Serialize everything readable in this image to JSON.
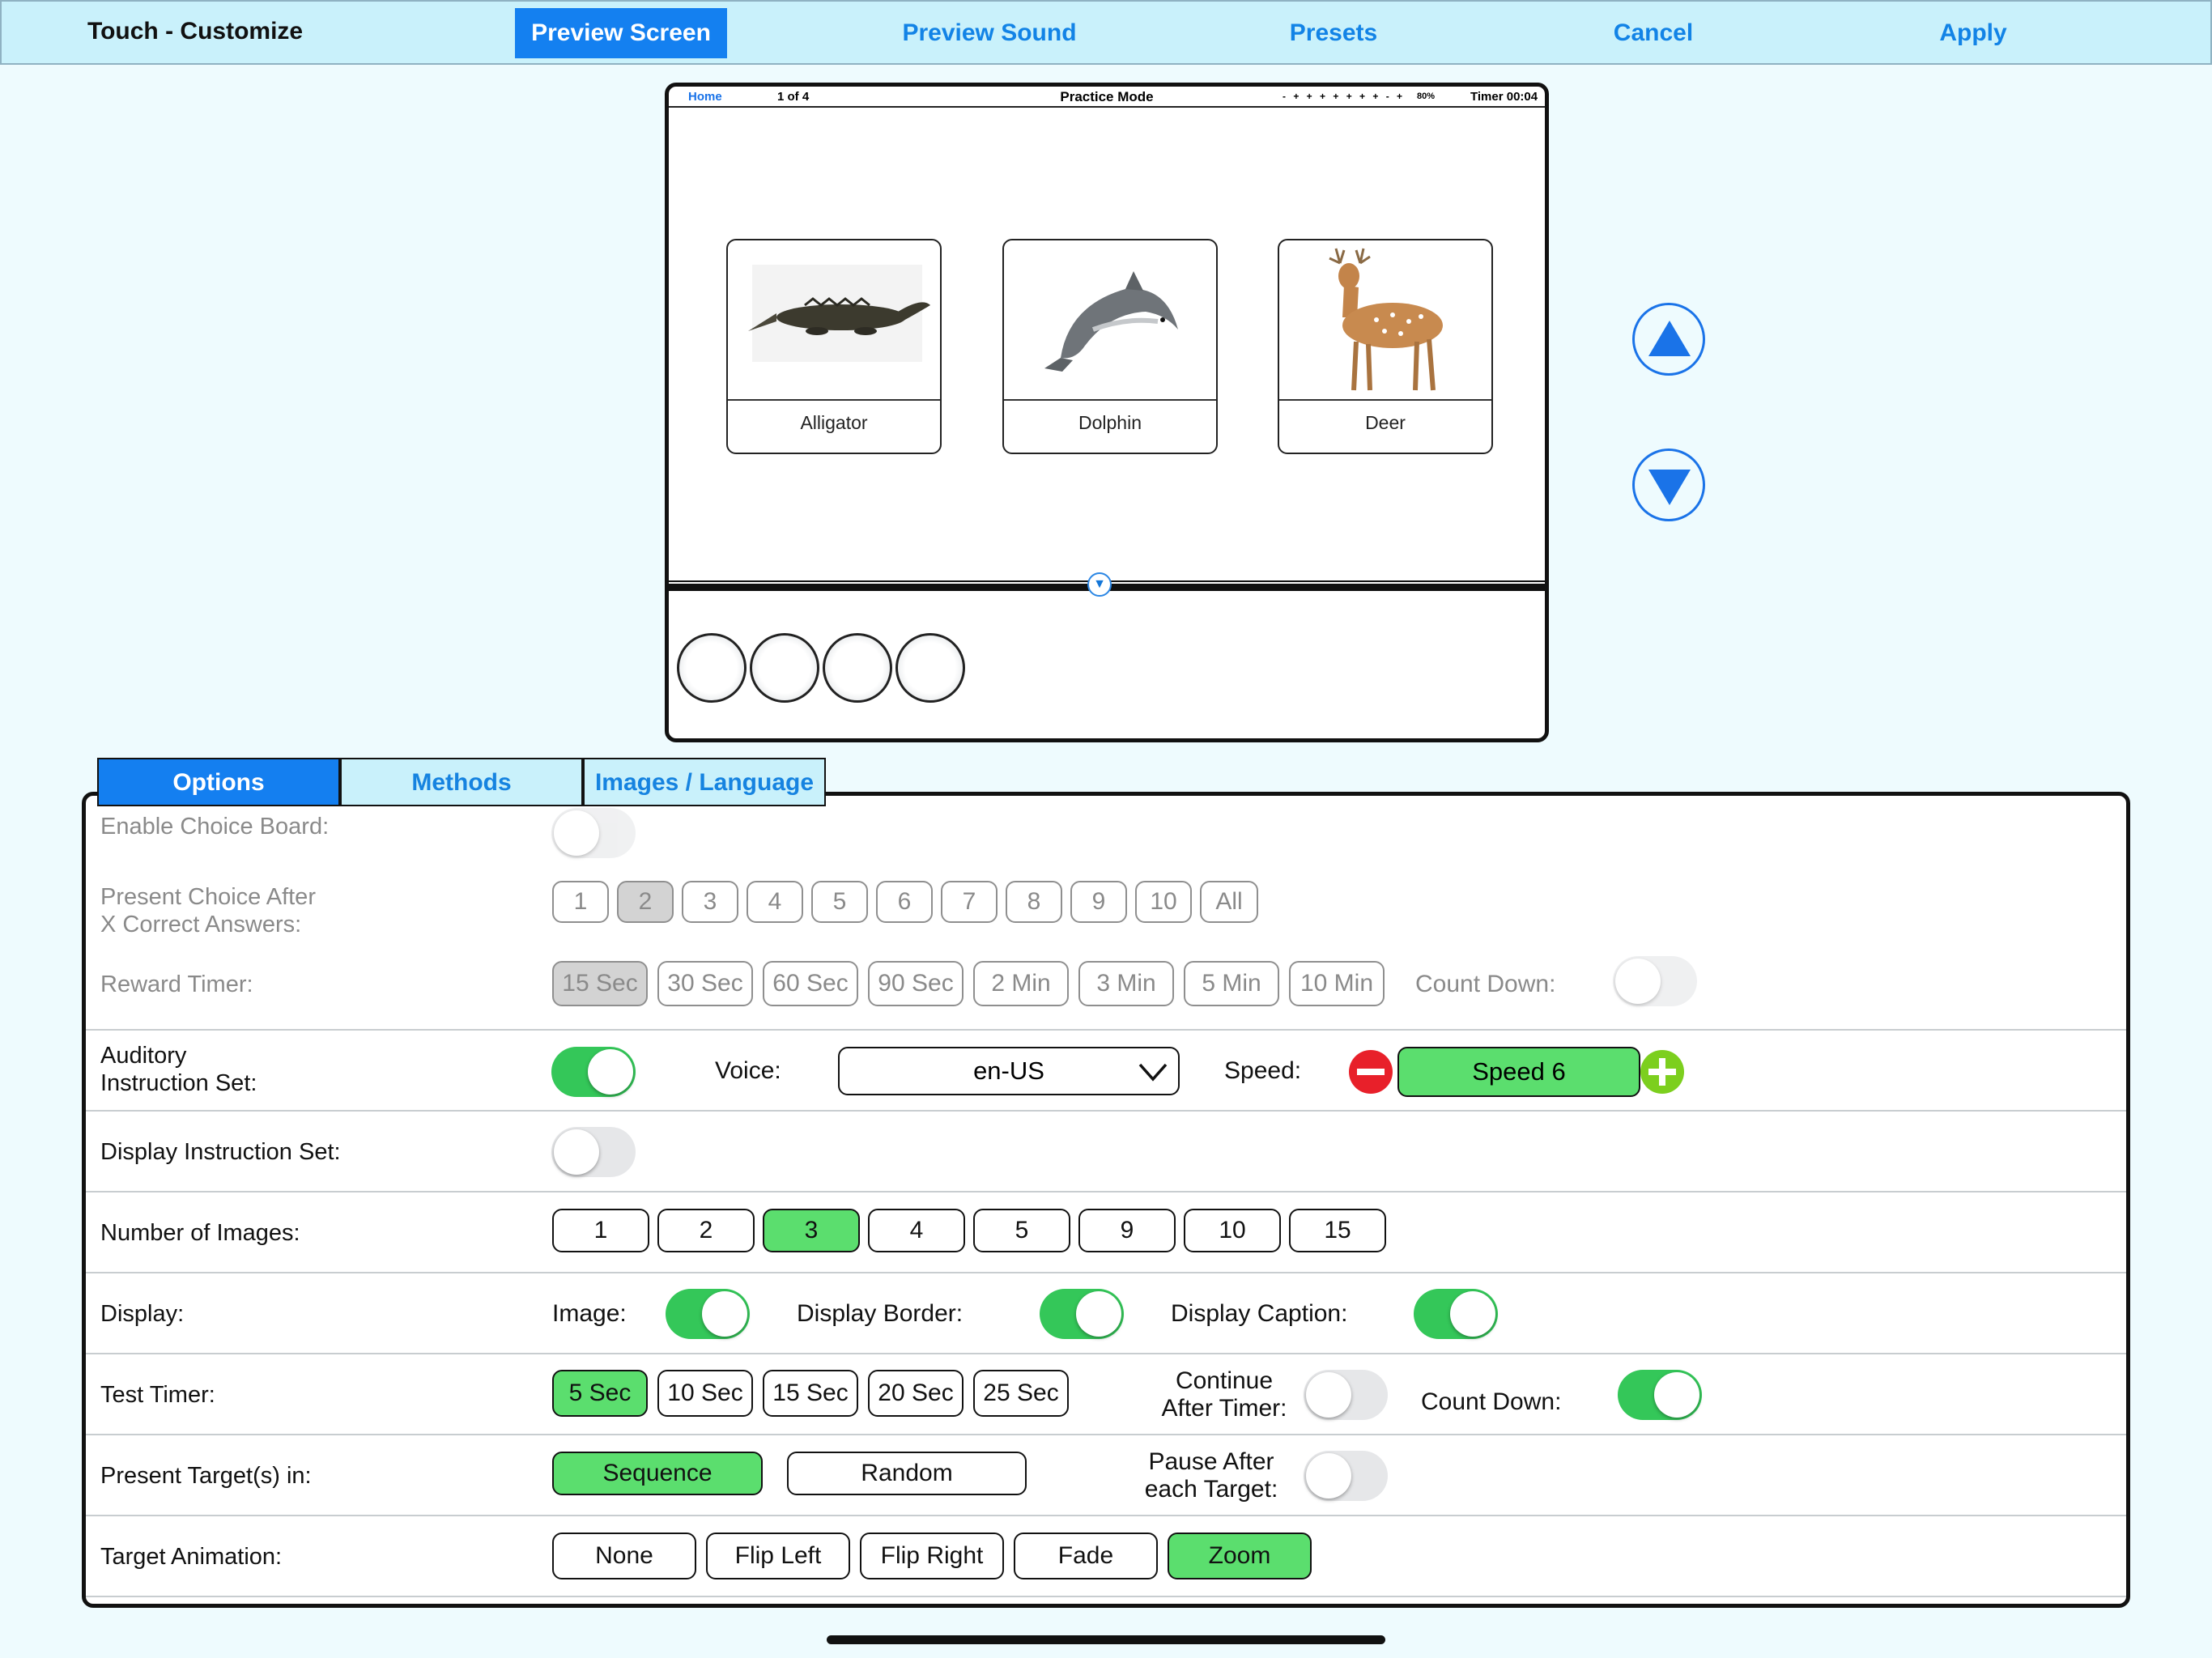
{
  "topbar": {
    "title": "Touch - Customize",
    "preview_screen": "Preview Screen",
    "preview_sound": "Preview Sound",
    "presets": "Presets",
    "cancel": "Cancel",
    "apply": "Apply"
  },
  "preview": {
    "home": "Home",
    "page": "1 of 4",
    "mode": "Practice Mode",
    "progress_dots": "- + + + + + + + - +",
    "percent": "80%",
    "timer": "Timer 00:04",
    "cards": [
      "Alligator",
      "Dolphin",
      "Deer"
    ]
  },
  "tabs": {
    "options": "Options",
    "methods": "Methods",
    "images_language": "Images / Language"
  },
  "options": {
    "enable_choice_board": {
      "label": "Enable Choice Board:",
      "on": false
    },
    "present_choice": {
      "label_line1": "Present Choice After",
      "label_line2": "X Correct Answers:",
      "choices": [
        "1",
        "2",
        "3",
        "4",
        "5",
        "6",
        "7",
        "8",
        "9",
        "10",
        "All"
      ],
      "selected": "2"
    },
    "reward_timer": {
      "label": "Reward Timer:",
      "choices": [
        "15 Sec",
        "30 Sec",
        "60 Sec",
        "90 Sec",
        "2 Min",
        "3 Min",
        "5 Min",
        "10 Min"
      ],
      "selected": "15 Sec",
      "count_down_label": "Count Down:",
      "count_down_on": false
    },
    "auditory": {
      "label_line1": "Auditory",
      "label_line2": "Instruction Set:",
      "on": true,
      "voice_label": "Voice:",
      "voice_value": "en-US",
      "speed_label": "Speed:",
      "speed_value": "Speed 6"
    },
    "display_instruction": {
      "label": "Display Instruction Set:",
      "on": false
    },
    "number_of_images": {
      "label": "Number of Images:",
      "choices": [
        "1",
        "2",
        "3",
        "4",
        "5",
        "9",
        "10",
        "15"
      ],
      "selected": "3"
    },
    "display": {
      "label": "Display:",
      "image_label": "Image:",
      "image_on": true,
      "border_label": "Display Border:",
      "border_on": true,
      "caption_label": "Display Caption:",
      "caption_on": true
    },
    "test_timer": {
      "label": "Test Timer:",
      "choices": [
        "5 Sec",
        "10 Sec",
        "15 Sec",
        "20 Sec",
        "25 Sec"
      ],
      "selected": "5 Sec",
      "continue_line1": "Continue",
      "continue_line2": "After Timer:",
      "continue_on": false,
      "count_down_label": "Count Down:",
      "count_down_on": true
    },
    "present_targets": {
      "label": "Present Target(s) in:",
      "sequence": "Sequence",
      "random": "Random",
      "selected": "Sequence",
      "pause_line1": "Pause After",
      "pause_line2": "each Target:",
      "pause_on": false
    },
    "target_animation": {
      "label": "Target Animation:",
      "choices": [
        "None",
        "Flip Left",
        "Flip Right",
        "Fade",
        "Zoom"
      ],
      "selected": "Zoom"
    }
  },
  "colors": {
    "accent_blue": "#147ff0",
    "selected_green": "#5bde6e",
    "switch_green": "#34c759",
    "background": "#eefbfe"
  }
}
